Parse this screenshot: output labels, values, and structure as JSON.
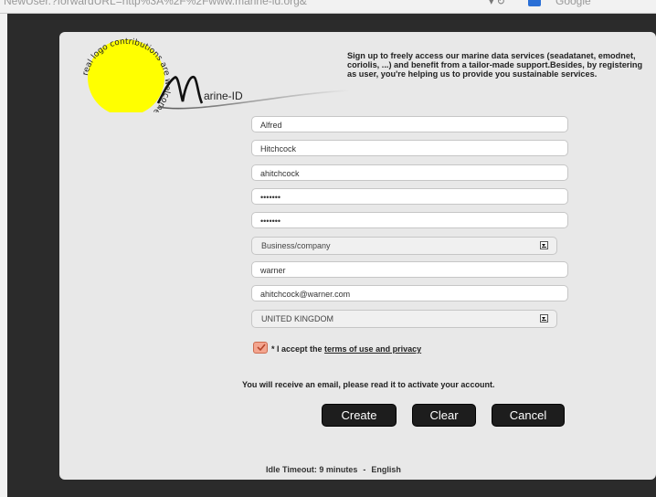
{
  "browser": {
    "url_fragment": "NewUser.?forwardURL=http%3A%2F%2Fwww.marine-id.org&",
    "search_engine": "Google"
  },
  "logo": {
    "circle_text": "real logo contributions are welcome !",
    "brand_text": "arine-ID",
    "circle_color": "#ffff00"
  },
  "intro": "Sign up to freely access our marine data services (seadatanet, emodnet, coriolis, ...) and benefit from a tailor-made support.Besides, by registering as user, you're helping us to provide you sustainable services.",
  "form": {
    "first_name": "Alfred",
    "last_name": "Hitchcock",
    "username": "ahitchcock",
    "password": "•••••••",
    "password_confirm": "•••••••",
    "organisation_type": "Business/company",
    "organisation": "warner",
    "email": "ahitchcock@warner.com",
    "country": "UNITED KINGDOM"
  },
  "terms": {
    "checked": true,
    "prefix": "* I accept the",
    "link": "terms of use and privacy"
  },
  "notice": "You will receive an email, please read it to activate your account.",
  "buttons": {
    "create": "Create",
    "clear": "Clear",
    "cancel": "Cancel"
  },
  "footer": {
    "idle": "Idle Timeout: 9 minutes",
    "separator": "-",
    "language": "English"
  },
  "colors": {
    "dialog_bg": "#e8e8e8",
    "button_bg": "#1d1d1d",
    "checkbox": "#f3a58f",
    "side_block": "#008000"
  }
}
